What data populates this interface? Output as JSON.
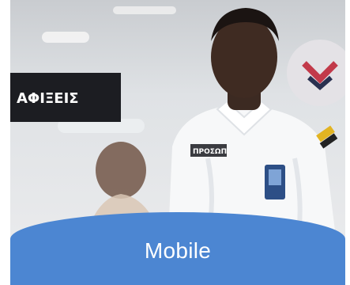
{
  "card": {
    "label": "Mobile",
    "photo_alt": "Airport staff member in white shirt",
    "sign_text": "ΑΦΙΞΕΙΣ",
    "badge_text": "ΠΡΟΣΩΠ."
  },
  "colors": {
    "banner": "#4c86d2",
    "label_text": "#ffffff"
  }
}
